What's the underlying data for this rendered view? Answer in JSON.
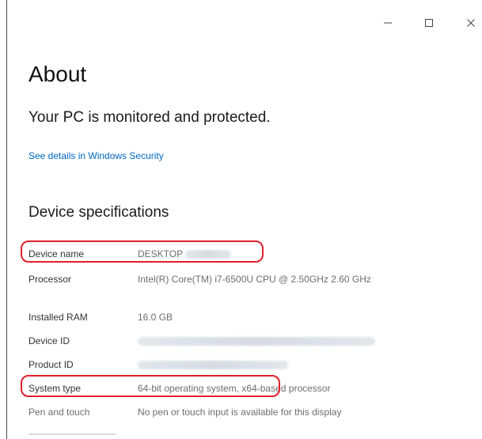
{
  "window": {
    "controls": {
      "minimize_icon": "minimize-icon",
      "maximize_icon": "maximize-icon",
      "close_icon": "close-icon"
    }
  },
  "page": {
    "title": "About",
    "protection_status": "Your PC is monitored and protected.",
    "security_link": "See details in Windows Security",
    "section_title": "Device specifications"
  },
  "specs": {
    "device_name": {
      "label": "Device name",
      "value": "DESKTOP"
    },
    "processor": {
      "label": "Processor",
      "value": "Intel(R) Core(TM) i7-6500U CPU @ 2.50GHz   2.60 GHz"
    },
    "installed_ram": {
      "label": "Installed RAM",
      "value": "16.0 GB"
    },
    "device_id": {
      "label": "Device ID"
    },
    "product_id": {
      "label": "Product ID"
    },
    "system_type": {
      "label": "System type",
      "value": "64-bit operating system, x64-based processor"
    },
    "pen_touch": {
      "label": "Pen and touch",
      "value": "No pen or touch input is available for this display"
    }
  },
  "colors": {
    "link": "#0067c0",
    "highlight": "#e0202c"
  }
}
